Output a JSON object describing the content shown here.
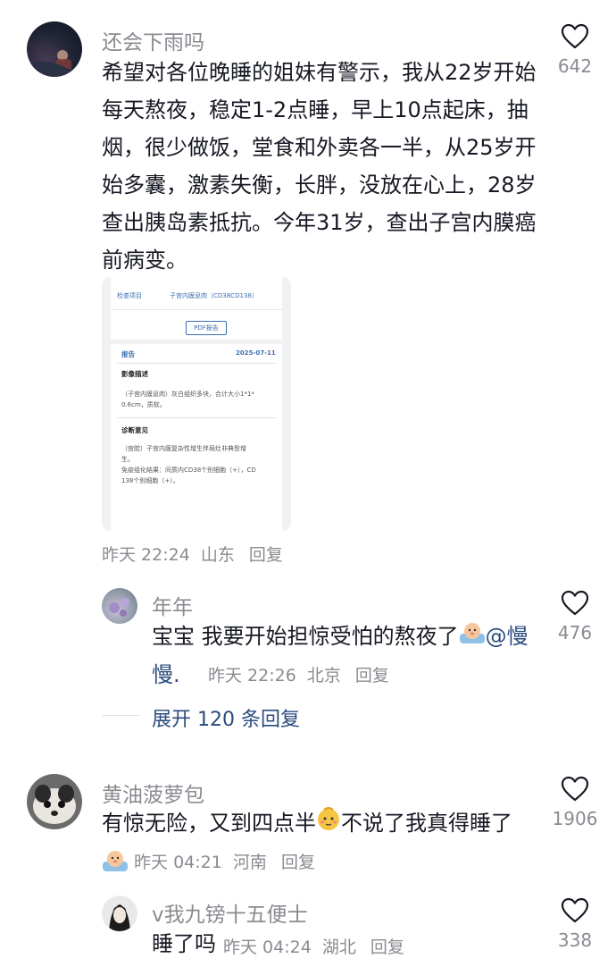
{
  "comments": [
    {
      "username": "还会下雨吗",
      "text": "希望对各位晚睡的姐妹有警示，我从22岁开始每天熬夜，稳定1-2点睡，早上10点起床，抽烟，很少做饭，堂食和外卖各一半，从25岁开始多囊，激素失衡，长胖，没放在心上，28岁查出胰岛素抵抗。今年31岁，查出子宫内膜癌前病变。",
      "time": "昨天 22:24",
      "location": "山东",
      "reply_label": "回复",
      "likes": "642",
      "image": {
        "row1_label": "检查项目",
        "row1_value": "子宫内膜息肉（CD38CD138）",
        "pdf_button": "PDF报告",
        "report_title": "报告",
        "report_date": "2025-07-11",
        "section1_title": "影像描述",
        "section1_line1": "（子宫内膜息肉）灰白组织多块，合计大小1*1*",
        "section1_line2": "0.6cm，质软。",
        "section2_title": "诊断意见",
        "section2_line1": "（宫腔）子宫内膜复杂性增生伴局灶非典型增",
        "section2_line2": "生。",
        "section2_line3": "免疫组化结果：间质内CD38个别细胞（+），CD",
        "section2_line4": "138个别细胞（+）。"
      }
    },
    {
      "username": "年年",
      "text": "宝宝 我要开始担惊受怕的熬夜了",
      "mention": "@慢慢.",
      "time": "昨天 22:26",
      "location": "北京",
      "reply_label": "回复",
      "likes": "476"
    },
    {
      "username": "黄油菠萝包",
      "text_part1": "有惊无险，又到四点半",
      "text_part2": "不说了我真得睡了",
      "time": "昨天 04:21",
      "location": "河南",
      "reply_label": "回复",
      "likes": "1906"
    },
    {
      "username": "v我九镑十五便士",
      "text": "睡了吗",
      "time": "昨天 04:24",
      "location": "湖北",
      "reply_label": "回复",
      "likes": "338"
    }
  ],
  "expand_replies": "展开 120 条回复",
  "colors": {
    "text": "#161823",
    "muted": "#8a8b91",
    "link": "#2b4c7e"
  },
  "icons": [
    "heart-outline-icon",
    "baby-face-emoji",
    "blushing-face-emoji"
  ]
}
